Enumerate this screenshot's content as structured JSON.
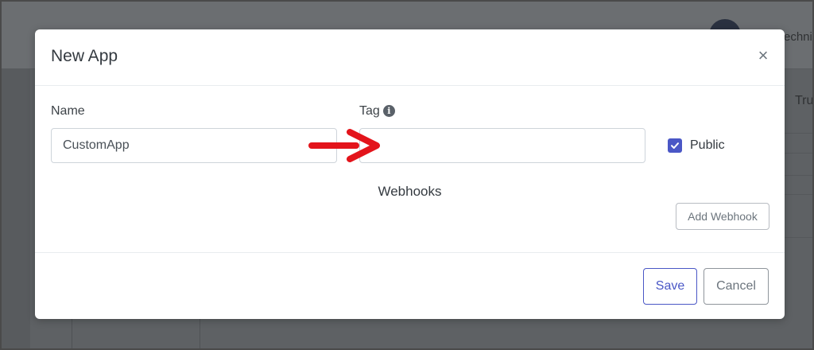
{
  "background": {
    "user_name_fragment": "echnic",
    "column_fragment": "Tru"
  },
  "modal": {
    "title": "New App",
    "close_glyph": "×",
    "close_icon": "close-icon",
    "fields": {
      "name": {
        "label": "Name",
        "value": "CustomApp",
        "placeholder": ""
      },
      "tag": {
        "label": "Tag",
        "value": "",
        "placeholder": "",
        "info_icon": "info-icon"
      },
      "public": {
        "label": "Public",
        "checked": true
      }
    },
    "webhooks": {
      "title": "Webhooks",
      "add_button_label": "Add Webhook"
    },
    "footer": {
      "save_label": "Save",
      "cancel_label": "Cancel"
    }
  },
  "annotation": {
    "type": "red-arrow",
    "color": "#e3141b",
    "points_to": "tag-input"
  },
  "colors": {
    "accent": "#4a57c6",
    "overlay": "#5e6164",
    "modal_bg": "#ffffff"
  }
}
